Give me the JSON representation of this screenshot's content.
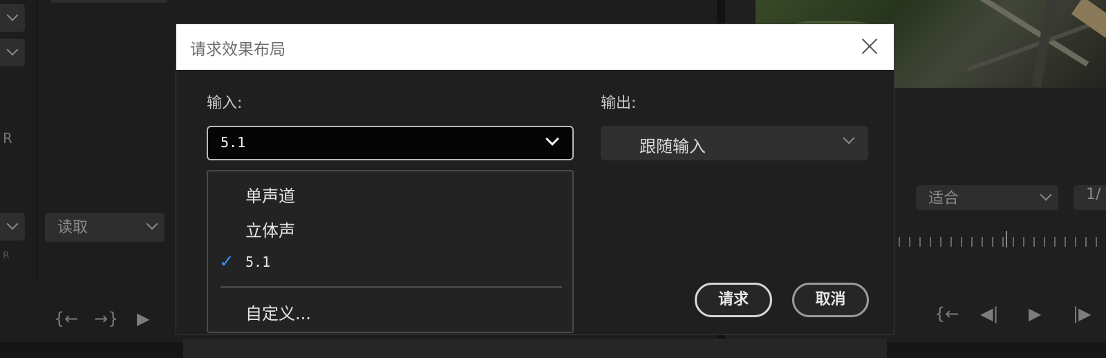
{
  "background": {
    "left_reader_dropdown": "读取",
    "fit_dropdown": "适合",
    "resolution_partial": "1/",
    "left_letters": [
      "R",
      "R"
    ]
  },
  "dialog": {
    "title": "请求效果布局",
    "input_label": "输入:",
    "output_label": "输出:",
    "input_value": "5.1",
    "output_value": "跟随输入",
    "menu_items": [
      {
        "label": "单声道",
        "checked": false
      },
      {
        "label": "立体声",
        "checked": false
      },
      {
        "label": "5.1",
        "checked": true
      },
      {
        "label": "自定义...",
        "checked": false
      }
    ],
    "check_glyph": "✓",
    "request_button": "请求",
    "cancel_button": "取消"
  },
  "colors": {
    "accent_check": "#3b8ef0",
    "dialog_bg": "#1f1f1f",
    "titlebar_bg": "#ffffff"
  }
}
